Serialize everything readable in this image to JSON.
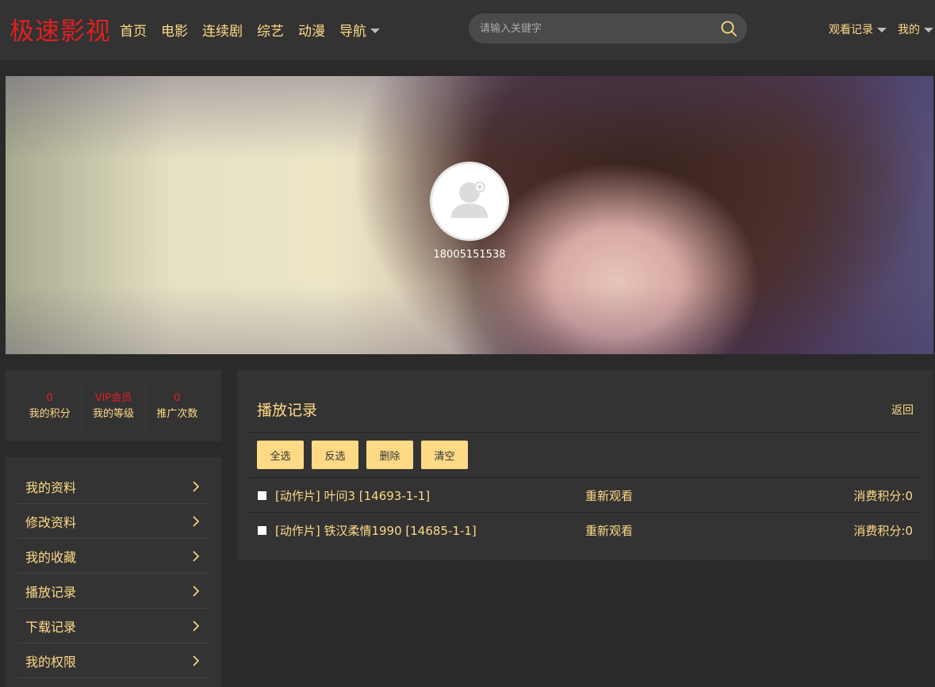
{
  "header": {
    "logo": "极速影视",
    "nav": [
      "首页",
      "电影",
      "连续剧",
      "综艺",
      "动漫",
      "导航"
    ],
    "search_placeholder": "请输入关键字",
    "right_nav": [
      "观看记录",
      "我的"
    ]
  },
  "banner": {
    "username": "18005151538"
  },
  "stats": [
    {
      "value": "0",
      "label": "我的积分"
    },
    {
      "value": "VIP会员",
      "label": "我的等级"
    },
    {
      "value": "0",
      "label": "推广次数"
    }
  ],
  "menu": [
    "我的资料",
    "修改资料",
    "我的收藏",
    "播放记录",
    "下载记录",
    "我的权限"
  ],
  "main": {
    "title": "播放记录",
    "back": "返回",
    "buttons": [
      "全选",
      "反选",
      "删除",
      "清空"
    ],
    "records": [
      {
        "title": "[动作片] 叶问3 [14693-1-1]",
        "action": "重新观看",
        "points": "消费积分:0"
      },
      {
        "title": "[动作片] 铁汉柔情1990 [14685-1-1]",
        "action": "重新观看",
        "points": "消费积分:0"
      }
    ]
  },
  "colors": {
    "accent": "#ffda86",
    "logo": "#e02020",
    "header_bg": "#333333",
    "page_bg": "#2a2a2a"
  }
}
